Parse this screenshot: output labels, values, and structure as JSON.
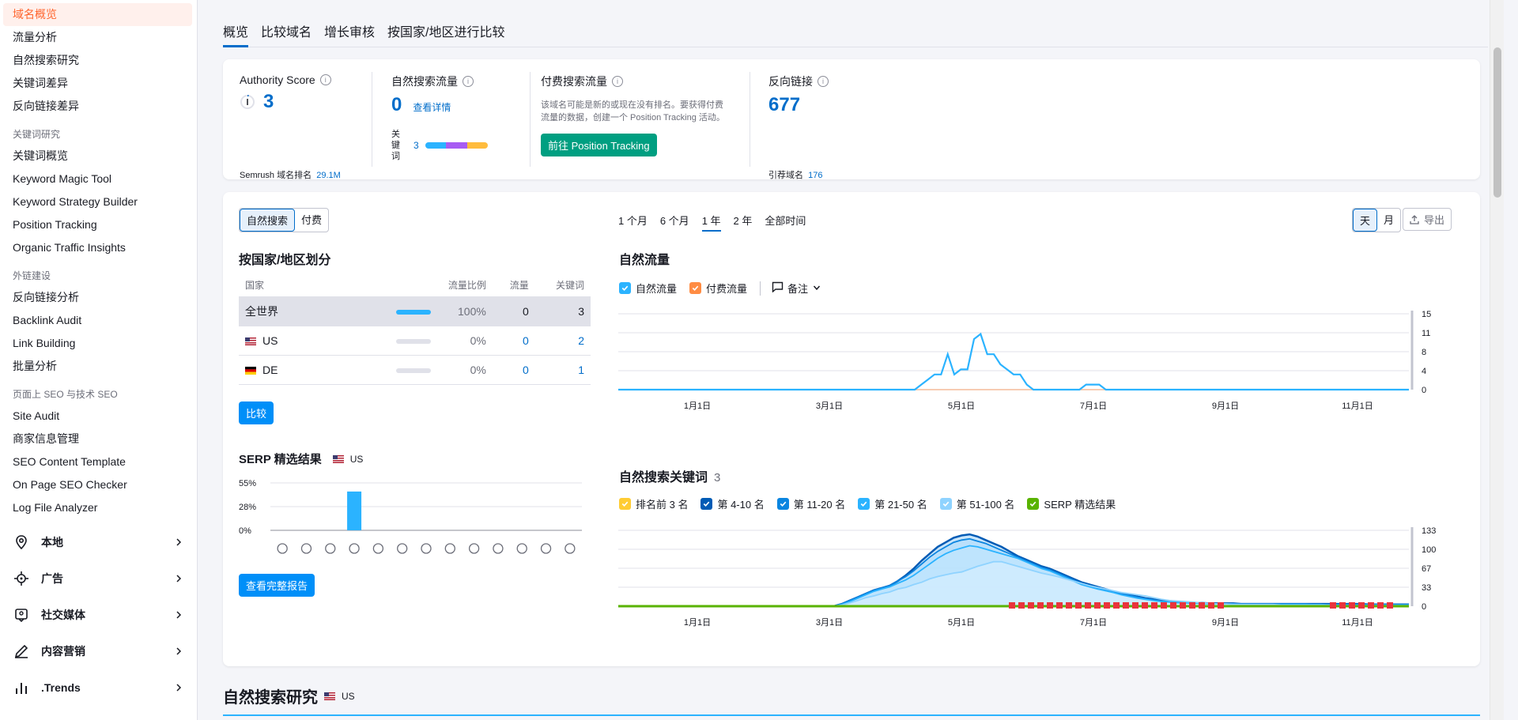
{
  "sidebar": {
    "items_top": [
      "域名概览",
      "流量分析",
      "自然搜索研究",
      "关键词差异",
      "反向链接差异"
    ],
    "group_kw": "关键词研究",
    "items_kw": [
      "关键词概览",
      "Keyword Magic Tool",
      "Keyword Strategy Builder",
      "Position Tracking",
      "Organic Traffic Insights"
    ],
    "group_link": "外链建设",
    "items_link": [
      "反向链接分析",
      "Backlink Audit",
      "Link Building",
      "批量分析"
    ],
    "group_seo": "页面上 SEO 与技术 SEO",
    "items_seo": [
      "Site Audit",
      "商家信息管理",
      "SEO Content Template",
      "On Page SEO Checker",
      "Log File Analyzer"
    ],
    "sections": [
      "本地",
      "广告",
      "社交媒体",
      "内容营销",
      ".Trends"
    ]
  },
  "tabs": [
    "概览",
    "比较域名",
    "增长审核",
    "按国家/地区进行比较"
  ],
  "summary": {
    "authority": {
      "label": "Authority Score",
      "value": "3",
      "sub_label": "Semrush 域名排名",
      "sub_value": "29.1M"
    },
    "organic": {
      "label": "自然搜索流量",
      "value": "0",
      "link": "查看详情",
      "kw_label": "关键词",
      "kw_value": "3"
    },
    "paid": {
      "label": "付费搜索流量",
      "desc": "该域名可能是新的或现在没有排名。要获得付费流量的数据，创建一个 Position Tracking 活动。",
      "button": "前往 Position Tracking"
    },
    "backlinks": {
      "label": "反向链接",
      "value": "677",
      "sub_label": "引荐域名",
      "sub_value": "176"
    }
  },
  "overview": {
    "seg_search": [
      "自然搜索",
      "付费"
    ],
    "periods": [
      "1 个月",
      "6 个月",
      "1 年",
      "2 年",
      "全部时间"
    ],
    "active_period": "1 年",
    "seg_granularity": [
      "天",
      "月"
    ],
    "export": "导出",
    "country_title": "按国家/地区划分",
    "country_headers": [
      "国家",
      "流量比例",
      "流量",
      "关键词"
    ],
    "countries": [
      {
        "name": "全世界",
        "share": "100%",
        "share_num": 100,
        "traffic": "0",
        "keywords": "3",
        "flag": ""
      },
      {
        "name": "US",
        "share": "0%",
        "share_num": 0,
        "traffic": "0",
        "keywords": "2",
        "flag": "us"
      },
      {
        "name": "DE",
        "share": "0%",
        "share_num": 0,
        "traffic": "0",
        "keywords": "1",
        "flag": "de"
      }
    ],
    "compare_btn": "比较",
    "serp_title": "SERP 精选结果",
    "serp_country": "US",
    "serp_y_ticks": [
      "55%",
      "28%",
      "0%"
    ],
    "serp_values": [
      0,
      0,
      0,
      45,
      0,
      0,
      0,
      0,
      0,
      0,
      0,
      0,
      0
    ],
    "serp_icons": [
      "crown-icon",
      "link-icon",
      "star-icon",
      "image-icon",
      "video-icon",
      "play-icon",
      "play-circle-icon",
      "comment-icon",
      "pin-icon",
      "cap-icon",
      "doc-icon",
      "bag-icon",
      "x-icon"
    ],
    "full_report_btn": "查看完整报告",
    "traffic_title": "自然流量",
    "traffic_legend": [
      {
        "label": "自然流量",
        "color": "#2bb3ff"
      },
      {
        "label": "付费流量",
        "color": "#ff8c43"
      }
    ],
    "notes_label": "备注",
    "kw_title": "自然搜索关键词",
    "kw_count": "3",
    "kw_legend": [
      {
        "label": "排名前 3 名",
        "color": "#ffcc33"
      },
      {
        "label": "第 4-10 名",
        "color": "#005bb5"
      },
      {
        "label": "第 11-20 名",
        "color": "#0b85e0"
      },
      {
        "label": "第 21-50 名",
        "color": "#2bb3ff"
      },
      {
        "label": "第 51-100 名",
        "color": "#8fd3ff"
      },
      {
        "label": "SERP 精选结果",
        "color": "#59b300"
      }
    ]
  },
  "chart_data": [
    {
      "type": "line",
      "title": "自然流量",
      "x_ticks": [
        "1月1日",
        "3月1日",
        "5月1日",
        "7月1日",
        "9月1日",
        "11月1日"
      ],
      "y_ticks": [
        "15",
        "11",
        "8",
        "4",
        "0"
      ],
      "ylim": [
        0,
        15
      ],
      "series": [
        {
          "name": "自然流量",
          "values": [
            0,
            0,
            0,
            0,
            0,
            0,
            0,
            0,
            0,
            0,
            0,
            0,
            0,
            0,
            0,
            0,
            0,
            0,
            0,
            0,
            0,
            0,
            0,
            0,
            0,
            0,
            0,
            0,
            0,
            0,
            0,
            0,
            0,
            0,
            0,
            0,
            0,
            0,
            0,
            0,
            0,
            0,
            0,
            0,
            0,
            0,
            1,
            2,
            3,
            3,
            7,
            3,
            4,
            4,
            10,
            11,
            7,
            7,
            5,
            4,
            3,
            3,
            1,
            0,
            0,
            0,
            0,
            0,
            0,
            0,
            0,
            1,
            1,
            1,
            0,
            0,
            0,
            0,
            0,
            0,
            0,
            0,
            0,
            0,
            0,
            0,
            0,
            0,
            0,
            0,
            0,
            0,
            0,
            0,
            0,
            0,
            0,
            0,
            0,
            0,
            0,
            0,
            0,
            0,
            0,
            0,
            0,
            0,
            0,
            0,
            0,
            0,
            0,
            0,
            0,
            0,
            0,
            0,
            0,
            0,
            0
          ]
        },
        {
          "name": "付费流量",
          "values": [
            0
          ]
        }
      ]
    },
    {
      "type": "area",
      "title": "自然搜索关键词",
      "x_ticks": [
        "1月1日",
        "3月1日",
        "5月1日",
        "7月1日",
        "9月1日",
        "11月1日"
      ],
      "y_ticks": [
        "133",
        "100",
        "67",
        "33",
        "0"
      ],
      "ylim": [
        0,
        133
      ],
      "series": [
        {
          "name": "第 51-100 名",
          "values": [
            0,
            0,
            0,
            0,
            0,
            0,
            0,
            0,
            0,
            0,
            0,
            0,
            0,
            0,
            0,
            0,
            0,
            0,
            0,
            0,
            0,
            0,
            0,
            0,
            0,
            0,
            0,
            0,
            2,
            6,
            10,
            15,
            18,
            22,
            25,
            30,
            33,
            38,
            42,
            48,
            52,
            55,
            58,
            60,
            65,
            70,
            74,
            78,
            78,
            74,
            70,
            66,
            62,
            58,
            55,
            52,
            48,
            44,
            40,
            36,
            33,
            30,
            27,
            24,
            22,
            20,
            18,
            15,
            12,
            10,
            9,
            8,
            7,
            6,
            5,
            4,
            4,
            3,
            3,
            3,
            3,
            3,
            3,
            2,
            2,
            2,
            2,
            2,
            2,
            2,
            1,
            1,
            1,
            1,
            1,
            1,
            1,
            1,
            1,
            1
          ]
        },
        {
          "name": "第 21-50 名",
          "values": [
            0,
            0,
            0,
            0,
            0,
            0,
            0,
            0,
            0,
            0,
            0,
            0,
            0,
            0,
            0,
            0,
            0,
            0,
            0,
            0,
            0,
            0,
            0,
            0,
            0,
            0,
            0,
            0,
            3,
            8,
            14,
            20,
            26,
            30,
            34,
            40,
            46,
            54,
            64,
            74,
            84,
            92,
            98,
            102,
            106,
            104,
            100,
            96,
            92,
            88,
            84,
            78,
            72,
            66,
            62,
            56,
            50,
            44,
            38,
            34,
            30,
            27,
            24,
            20,
            17,
            14,
            12,
            10,
            8,
            7,
            6,
            6,
            5,
            5,
            4,
            4,
            4,
            4,
            3,
            3,
            3,
            3,
            3,
            3,
            3,
            3,
            3,
            3,
            3,
            2,
            2,
            2,
            2,
            2,
            2,
            2,
            2,
            2,
            2,
            2
          ]
        },
        {
          "name": "第 11-20 名",
          "values": [
            0,
            0,
            0,
            0,
            0,
            0,
            0,
            0,
            0,
            0,
            0,
            0,
            0,
            0,
            0,
            0,
            0,
            0,
            0,
            0,
            0,
            0,
            0,
            0,
            0,
            0,
            0,
            0,
            4,
            10,
            16,
            22,
            28,
            32,
            36,
            44,
            52,
            62,
            74,
            86,
            96,
            104,
            112,
            116,
            118,
            114,
            110,
            104,
            98,
            92,
            86,
            80,
            74,
            68,
            64,
            58,
            52,
            46,
            40,
            36,
            32,
            28,
            25,
            22,
            19,
            16,
            13,
            11,
            9,
            8,
            7,
            6,
            6,
            5,
            5,
            4,
            4,
            4,
            4,
            4,
            4,
            4,
            4,
            4,
            4,
            4,
            4,
            3,
            3,
            3,
            3,
            3,
            3,
            3,
            3,
            3,
            3,
            3,
            3,
            3
          ]
        },
        {
          "name": "第 4-10 名",
          "values": [
            0,
            0,
            0,
            0,
            0,
            0,
            0,
            0,
            0,
            0,
            0,
            0,
            0,
            0,
            0,
            0,
            0,
            0,
            0,
            0,
            0,
            0,
            0,
            0,
            0,
            0,
            0,
            0,
            4,
            10,
            16,
            22,
            28,
            32,
            36,
            44,
            54,
            66,
            80,
            92,
            104,
            112,
            120,
            124,
            126,
            122,
            116,
            110,
            104,
            96,
            88,
            82,
            76,
            70,
            66,
            60,
            54,
            48,
            42,
            38,
            34,
            30,
            26,
            23,
            20,
            17,
            14,
            12,
            10,
            9,
            8,
            7,
            6,
            6,
            5,
            5,
            5,
            5,
            4,
            4,
            4,
            4,
            4,
            4,
            4,
            4,
            4,
            4,
            4,
            4,
            4,
            4,
            4,
            4,
            3,
            3,
            3,
            3,
            3,
            3
          ]
        },
        {
          "name": "SERP 精选结果",
          "values": [
            0
          ]
        }
      ]
    },
    {
      "type": "bar",
      "title": "SERP 精选结果",
      "y_ticks": [
        "55%",
        "28%",
        "0%"
      ],
      "ylim": [
        0,
        55
      ],
      "values": [
        0,
        0,
        0,
        45,
        0,
        0,
        0,
        0,
        0,
        0,
        0,
        0,
        0
      ]
    }
  ],
  "bottom": {
    "title": "自然搜索研究",
    "country": "US"
  },
  "help": "?",
  "colors": {
    "brand_orange": "#ff642d",
    "blue": "#006dca",
    "green": "#009f81",
    "light_blue": "#2bb3ff"
  }
}
